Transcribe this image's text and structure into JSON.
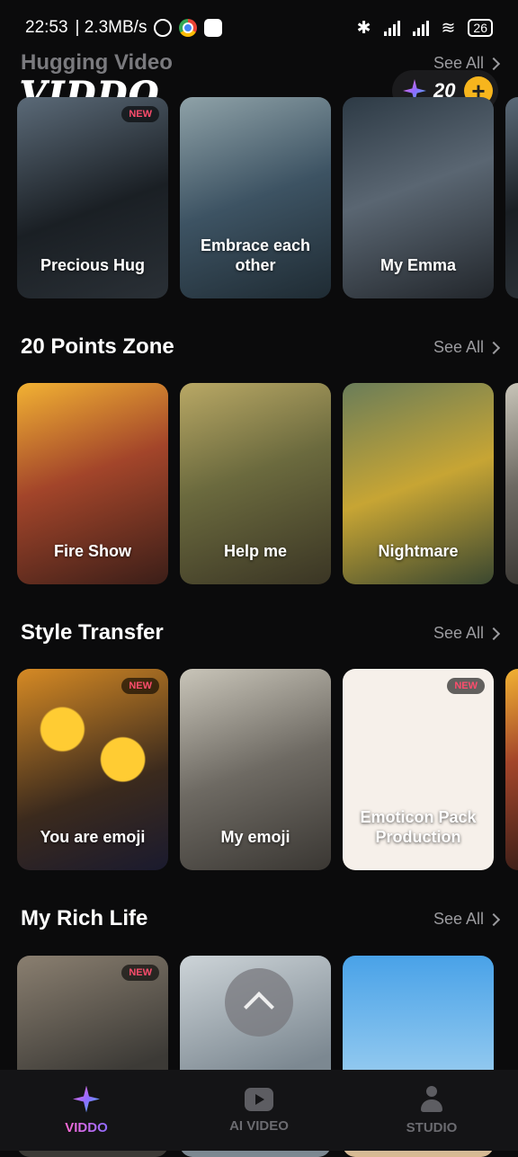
{
  "status": {
    "time": "22:53",
    "speed": "| 2.3MB/s",
    "battery": "26"
  },
  "header": {
    "logo": "VIDDO",
    "points": "20"
  },
  "sections": [
    {
      "title": "Hugging Video",
      "see_all": "See All",
      "cards": [
        {
          "title": "Precious Hug",
          "badge": "NEW"
        },
        {
          "title": "Embrace each other"
        },
        {
          "title": "My Emma"
        }
      ]
    },
    {
      "title": "20 Points Zone",
      "see_all": "See All",
      "cards": [
        {
          "title": "Fire Show"
        },
        {
          "title": "Help me"
        },
        {
          "title": "Nightmare"
        }
      ]
    },
    {
      "title": "Style Transfer",
      "see_all": "See All",
      "cards": [
        {
          "title": "You are emoji",
          "badge": "NEW"
        },
        {
          "title": "My emoji"
        },
        {
          "title": "Emoticon Pack Production",
          "badge": "NEW"
        }
      ]
    },
    {
      "title": "My Rich Life",
      "see_all": "See All",
      "cards": [
        {
          "title": "",
          "badge": "NEW"
        },
        {
          "title": ""
        },
        {
          "title": ""
        }
      ]
    }
  ],
  "tabs": [
    {
      "label": "VIDDO",
      "icon": "sparkle-icon",
      "active": true
    },
    {
      "label": "AI VIDEO",
      "icon": "video-icon"
    },
    {
      "label": "STUDIO",
      "icon": "user-icon"
    }
  ]
}
